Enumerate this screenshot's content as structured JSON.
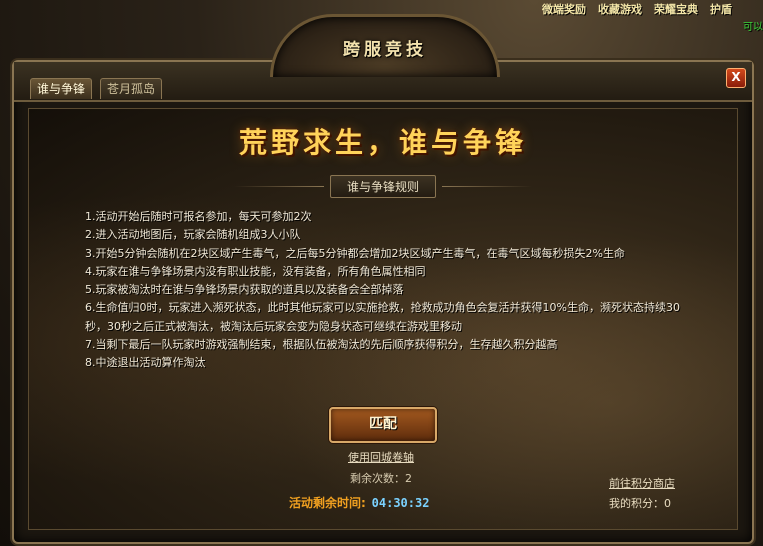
{
  "hud": {
    "items": [
      "微端奖励",
      "收藏游戏",
      "荣耀宝典",
      "护盾"
    ],
    "status": "可以"
  },
  "plaque": {
    "title": "跨服竞技"
  },
  "tabs": [
    {
      "label": "谁与争锋",
      "active": true
    },
    {
      "label": "苍月孤岛",
      "active": false
    }
  ],
  "close_label": "X",
  "banner": {
    "title": "荒野求生，谁与争锋"
  },
  "rules_label": "谁与争锋规则",
  "rules": [
    "1.活动开始后随时可报名参加，每天可参加2次",
    "2.进入活动地图后，玩家会随机组成3人小队",
    "3.开始5分钟会随机在2块区域产生毒气，之后每5分钟都会增加2块区域产生毒气，在毒气区域每秒损失2%生命",
    "4.玩家在谁与争锋场景内没有职业技能，没有装备，所有角色属性相同",
    "5.玩家被淘汰时在谁与争锋场景内获取的道具以及装备会全部掉落",
    "6.生命值归0时，玩家进入濒死状态，此时其他玩家可以实施抢救，抢救成功角色会复活并获得10%生命，濒死状态持续30秒，30秒之后正式被淘汰，被淘汰后玩家会变为隐身状态可继续在游戏里移动",
    "7.当剩下最后一队玩家时游戏强制结束，根据队伍被淘汰的先后顺序获得积分，生存越久积分越高",
    "8.中途退出活动算作淘汰"
  ],
  "match_button": "匹配",
  "scroll_link": "使用回城卷轴",
  "remaining_label": "剩余次数：2",
  "timer": {
    "label": "活动剩余时间:",
    "value": "04:30:32"
  },
  "shop_link": "前往积分商店",
  "points_label": "我的积分：0",
  "colors": {
    "accent": "#ffd35a",
    "timer": "#7bd2ff",
    "timer_label": "#f0a020"
  }
}
